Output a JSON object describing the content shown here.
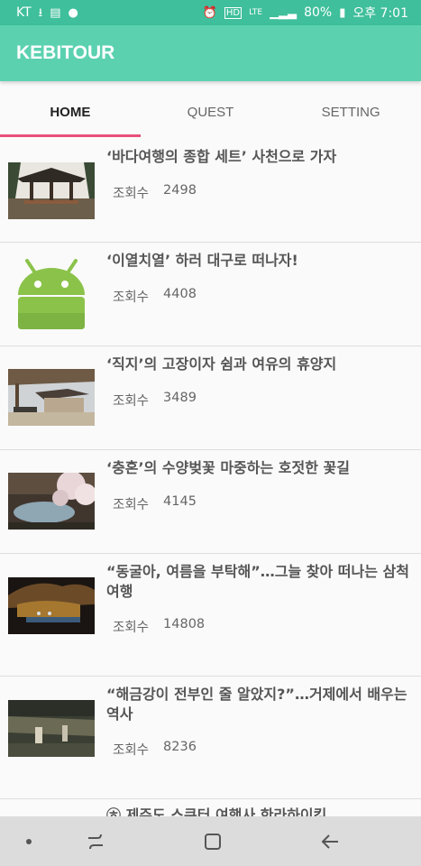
{
  "status_bar": {
    "carrier": "KT",
    "battery": "80%",
    "time": "오후 7:01",
    "lte": "LTE",
    "hd": "HD"
  },
  "app": {
    "title": "KEBITOUR"
  },
  "tabs": [
    {
      "label": "HOME",
      "active": true
    },
    {
      "label": "QUEST",
      "active": false
    },
    {
      "label": "SETTING",
      "active": false
    }
  ],
  "list": {
    "views_label": "조회수",
    "items": [
      {
        "title": "‘바다여행의 종합 세트’ 사천으로 가자",
        "views": "2498"
      },
      {
        "title": "‘이열치열’ 하러 대구로 떠나자!",
        "views": "4408"
      },
      {
        "title": "‘직지’의 고장이자 쉼과 여유의 휴양지",
        "views": "3489"
      },
      {
        "title": "‘충혼’의 수양벚꽃 마중하는 호젓한 꽃길",
        "views": "4145"
      },
      {
        "title": "“동굴아, 여름을 부탁해”…그늘 찾아 떠나는 삼척여행",
        "views": "14808"
      },
      {
        "title": "“해금강이 전부인 줄 알았지?”…거제에서 배우는 역사",
        "views": "8236"
      },
      {
        "title": "㉭ 제주도 스쿠터 여행사 한라하이킹",
        "views": ""
      }
    ]
  },
  "colors": {
    "status_bar": "#3fbf9b",
    "app_bar": "#5bd1b0",
    "tab_indicator": "#e8507a",
    "nav_bar": "#dcdcdc"
  }
}
